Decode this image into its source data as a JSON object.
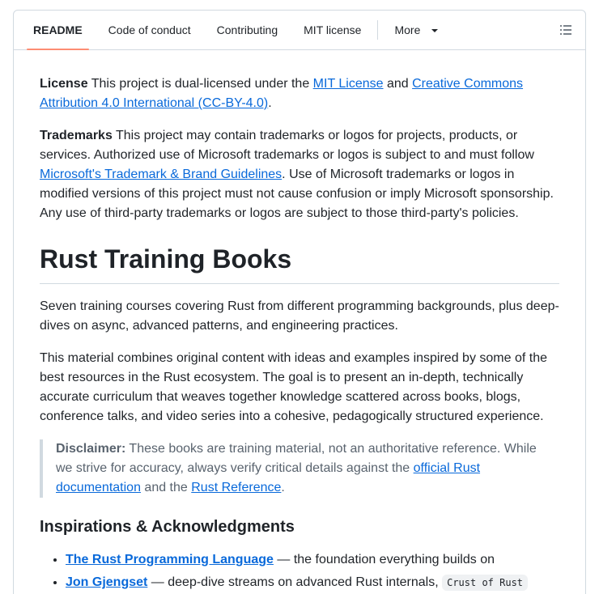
{
  "tabs": {
    "readme": "README",
    "code_of_conduct": "Code of conduct",
    "contributing": "Contributing",
    "mit_license": "MIT license",
    "more": "More"
  },
  "license": {
    "label": "License",
    "text1": " This project is dual-licensed under the ",
    "link_mit": "MIT License",
    "text2": " and ",
    "link_cc": "Creative Commons Attribution 4.0 International (CC-BY-4.0)",
    "text3": "."
  },
  "trademarks": {
    "label": "Trademarks",
    "text1": " This project may contain trademarks or logos for projects, products, or services. Authorized use of Microsoft trademarks or logos is subject to and must follow ",
    "link": "Microsoft's Trademark & Brand Guidelines",
    "text2": ". Use of Microsoft trademarks or logos in modified versions of this project must not cause confusion or imply Microsoft sponsorship. Any use of third-party trademarks or logos are subject to those third-party's policies."
  },
  "heading": "Rust Training Books",
  "intro": "Seven training courses covering Rust from different programming backgrounds, plus deep-dives on async, advanced patterns, and engineering practices.",
  "material": "This material combines original content with ideas and examples inspired by some of the best resources in the Rust ecosystem. The goal is to present an in-depth, technically accurate curriculum that weaves together knowledge scattered across books, blogs, conference talks, and video series into a cohesive, pedagogically structured experience.",
  "disclaimer": {
    "label": "Disclaimer:",
    "text1": " These books are training material, not an authoritative reference. While we strive for accuracy, always verify critical details against the ",
    "link_docs": "official Rust documentation",
    "text2": " and the ",
    "link_ref": "Rust Reference",
    "text3": "."
  },
  "inspirations_heading": "Inspirations & Acknowledgments",
  "inspirations": [
    {
      "link": "The Rust Programming Language",
      "text": " — the foundation everything builds on"
    },
    {
      "link": "Jon Gjengset",
      "text": " — deep-dive streams on advanced Rust internals, ",
      "code": "Crust of Rust"
    }
  ]
}
